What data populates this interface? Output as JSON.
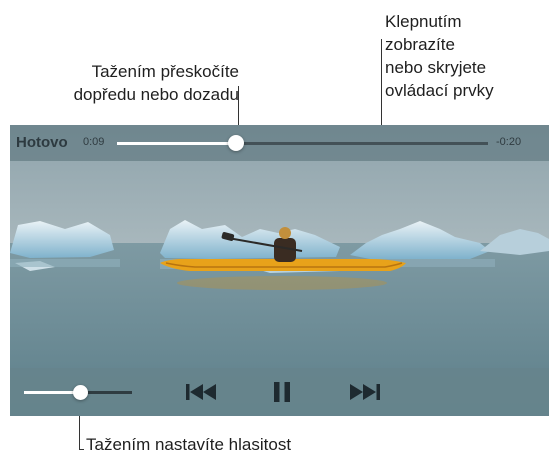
{
  "annotations": {
    "scrub": [
      "Tažením přeskočíte",
      "dopředu nebo dozadu"
    ],
    "toggle_controls": [
      "Klepnutím",
      "zobrazíte",
      "nebo skryjete",
      "ovládací prvky"
    ],
    "volume": "Tažením nastavíte hlasitost"
  },
  "player": {
    "done_label": "Hotovo",
    "elapsed": "0:09",
    "remaining": "-0:20",
    "progress_fraction": 0.32,
    "volume_fraction": 0.52,
    "state": "playing",
    "controls": [
      "previous-track-icon",
      "pause-icon",
      "next-track-icon"
    ]
  },
  "colors": {
    "bar_background": "#667e85",
    "control_glyph": "#1e2a30",
    "kayak": "#e8a21a"
  }
}
